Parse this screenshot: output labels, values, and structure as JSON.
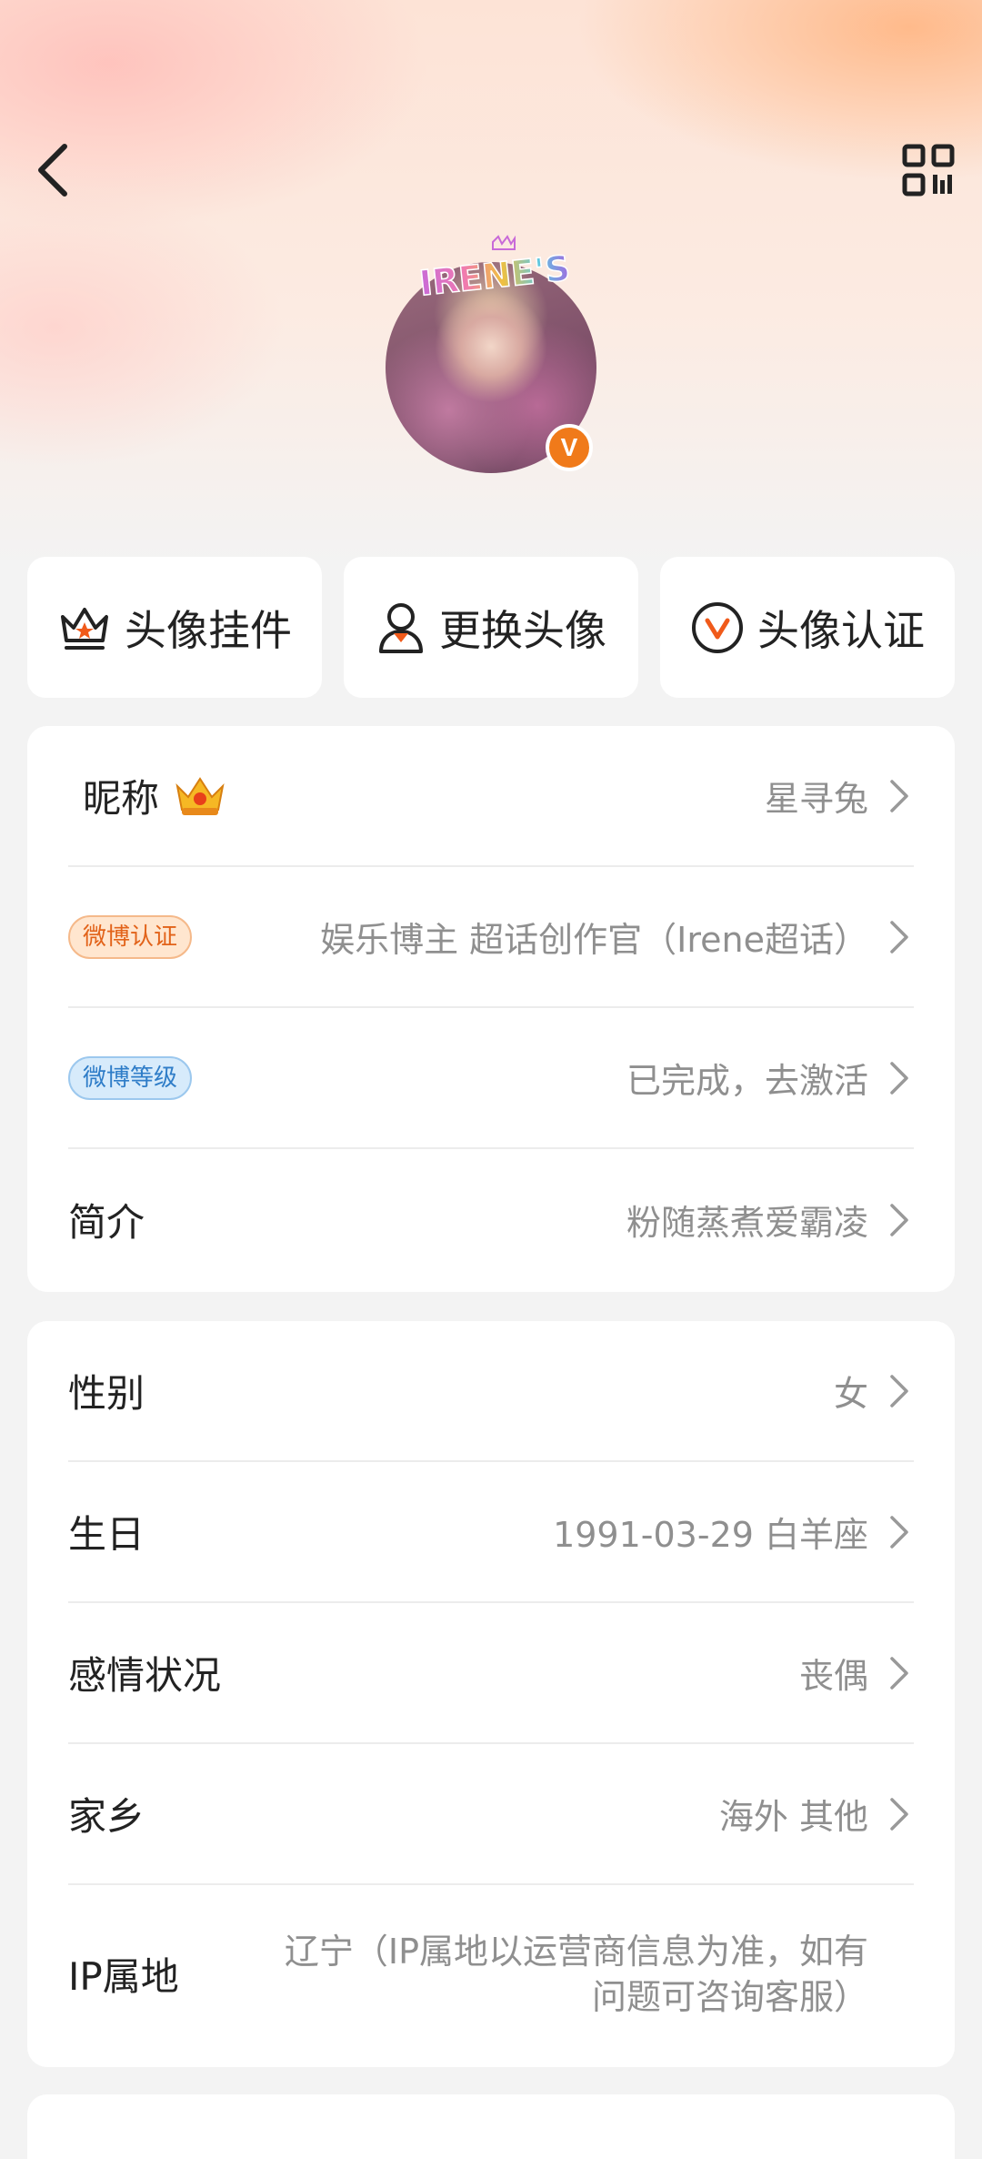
{
  "header": {
    "back_icon": "chevron-left-icon",
    "qr_icon": "qr-code-icon"
  },
  "avatar": {
    "pendant_text": "IRENE'S",
    "verified_badge": "V"
  },
  "quick_actions": [
    {
      "label": "头像挂件",
      "icon": "crown-icon"
    },
    {
      "label": "更换头像",
      "icon": "person-icon"
    },
    {
      "label": "头像认证",
      "icon": "v-badge-icon"
    }
  ],
  "profile_card": {
    "nickname": {
      "label": "昵称",
      "value": "星寻兔"
    },
    "weibo_verify": {
      "badge": "微博认证",
      "value": "娱乐博主 超话创作官（Irene超话）"
    },
    "weibo_level": {
      "badge": "微博等级",
      "value": "已完成，去激活"
    },
    "bio": {
      "label": "简介",
      "value": "粉随蒸煮爱霸凌"
    }
  },
  "info_card": {
    "gender": {
      "label": "性别",
      "value": "女"
    },
    "birthday": {
      "label": "生日",
      "value": "1991-03-29 白羊座"
    },
    "relationship": {
      "label": "感情状况",
      "value": "丧偶"
    },
    "hometown": {
      "label": "家乡",
      "value": "海外 其他"
    },
    "ip": {
      "label": "IP属地",
      "value": "辽宁（IP属地以运营商信息为准，如有问题可咨询客服）"
    }
  },
  "colors": {
    "accent_orange": "#f07a1a",
    "badge_blue": "#2f7dc8",
    "value_gray": "#8f8f8f"
  }
}
